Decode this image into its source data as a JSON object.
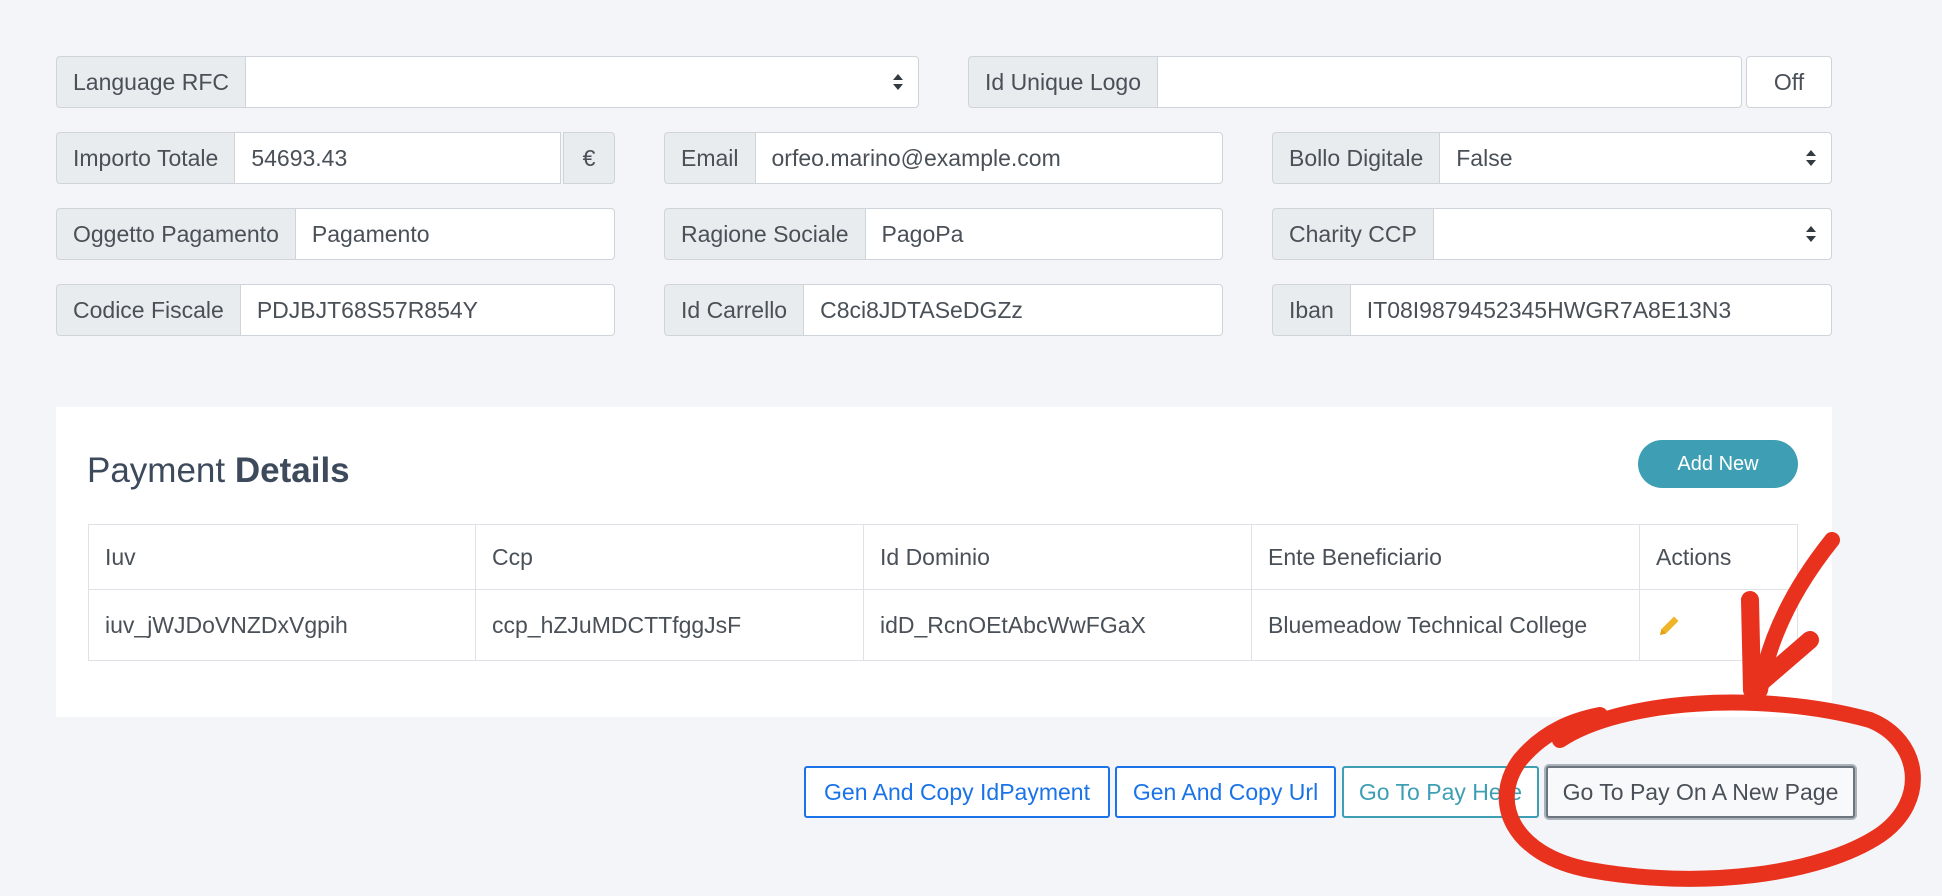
{
  "form": {
    "language_rfc": {
      "label": "Language RFC",
      "value": ""
    },
    "id_unique_logo": {
      "label": "Id Unique Logo",
      "value": "",
      "toggle": "Off"
    },
    "importo_totale": {
      "label": "Importo Totale",
      "value": "54693.43",
      "currency": "€"
    },
    "email": {
      "label": "Email",
      "value": "orfeo.marino@example.com"
    },
    "bollo_digitale": {
      "label": "Bollo Digitale",
      "value": "False"
    },
    "oggetto_pagamento": {
      "label": "Oggetto Pagamento",
      "value": "Pagamento"
    },
    "ragione_sociale": {
      "label": "Ragione Sociale",
      "value": "PagoPa"
    },
    "charity_ccp": {
      "label": "Charity CCP",
      "value": ""
    },
    "codice_fiscale": {
      "label": "Codice Fiscale",
      "value": "PDJBJT68S57R854Y"
    },
    "id_carrello": {
      "label": "Id Carrello",
      "value": "C8ci8JDTASeDGZz"
    },
    "iban": {
      "label": "Iban",
      "value": "IT08I9879452345HWGR7A8E13N3"
    }
  },
  "payment_details": {
    "title_light": "Payment",
    "title_bold": "Details",
    "add_new": "Add New",
    "columns": [
      "Iuv",
      "Ccp",
      "Id Dominio",
      "Ente Beneficiario",
      "Actions"
    ],
    "rows": [
      {
        "iuv": "iuv_jWJDoVNZDxVgpih",
        "ccp": "ccp_hZJuMDCTTfggJsF",
        "id_dominio": "idD_RcnOEtAbcWwFGaX",
        "ente": "Bluemeadow Technical College",
        "action_icon": "pencil-icon"
      }
    ]
  },
  "actions": {
    "gen_copy_idpayment": "Gen And Copy IdPayment",
    "gen_copy_url": "Gen And Copy Url",
    "go_pay_here": "Go To Pay Here",
    "go_pay_new_page": "Go To Pay On A New Page"
  },
  "colors": {
    "accent_teal": "#3e9fb4",
    "link_blue": "#1a73e8",
    "annotation_red": "#e8321e",
    "edit_icon": "#f0b429"
  }
}
